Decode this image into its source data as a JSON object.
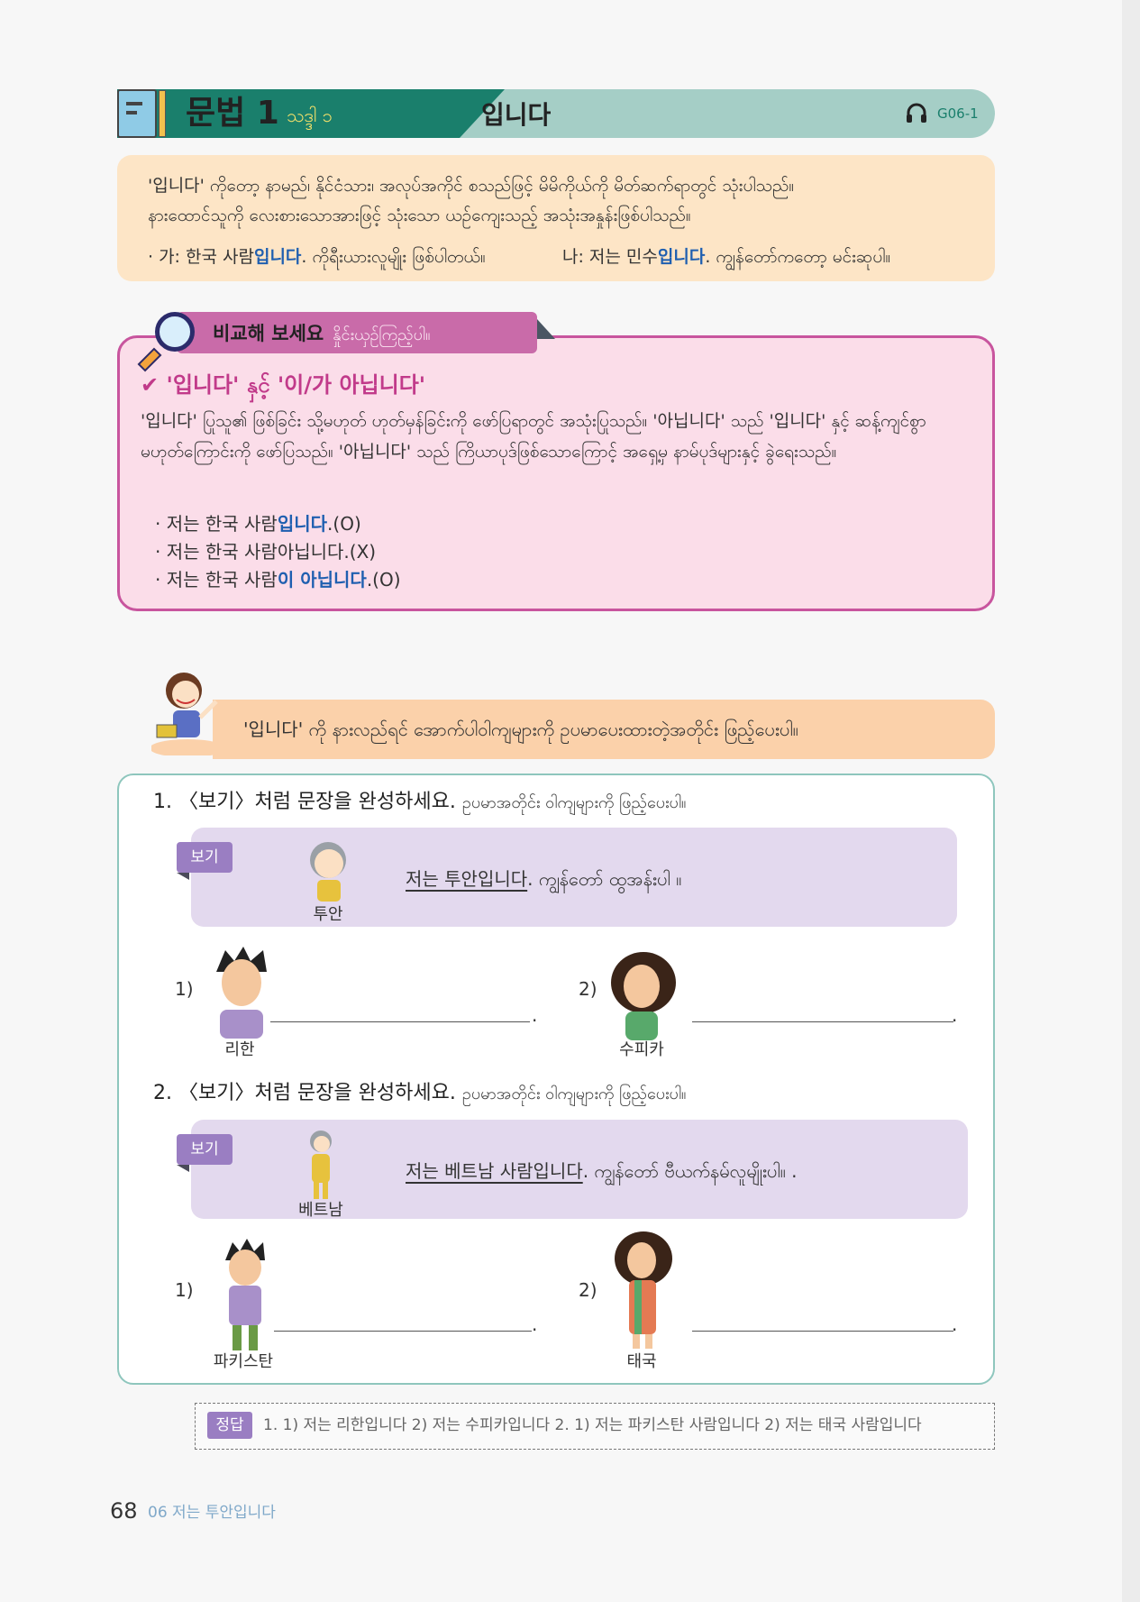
{
  "header": {
    "title": "문법 1",
    "subtitle": "သဒ္ဒါ ၁",
    "topic": "입니다",
    "audio_code": "G06-1"
  },
  "explanation": {
    "line1": "'입니다' ကိုတော့ နာမည်၊ နိုင်ငံသား၊ အလုပ်အကိုင် စသည်ဖြင့် မိမိကိုယ်ကို မိတ်ဆက်ရာတွင် သုံးပါသည်။",
    "line2": "နားထောင်သူကို လေးစားသောအားဖြင့် သုံးသော ယဉ်ကျေးသည့် အသုံးအနှုန်းဖြစ်ပါသည်။",
    "ex1_pre": "· 가: 한국 사람",
    "ex1_hl": "입니다",
    "ex1_post": ". ကိုရီးယားလူမျိုး ဖြစ်ပါတယ်။",
    "ex2_pre": "나: 저는 민수",
    "ex2_hl": "입니다",
    "ex2_post": ". ကျွန်တော်ကတော့ မင်းဆုပါ။"
  },
  "compare": {
    "label": "비교해 보세요",
    "label_sub": "နှိုင်းယှဉ်ကြည့်ပါ။",
    "heading": "✔ '입니다' နှင့် '이/가 아닙니다'",
    "text": "'입니다' ပြုသူ၏ ဖြစ်ခြင်း သို့မဟုတ် ဟုတ်မှန်ခြင်းကို ဖော်ပြရာတွင် အသုံးပြုသည်။ '아닙니다' သည် '입니다' နှင့် ဆန့်ကျင်စွာ မဟုတ်ကြောင်းကို ဖော်ပြသည်။ '아닙니다' သည် ကြိယာပုဒ်ဖြစ်သောကြောင့် အရှေ့မှ နာမ်ပုဒ်များနှင့် ခွဲရေးသည်။",
    "ex1_pre": "· 저는 한국 사람",
    "ex1_hl": "입니다",
    "ex1_post": ".(O)",
    "ex2": "· 저는 한국 사람아닙니다.(X)",
    "ex3_pre": "· 저는 한국 사람",
    "ex3_hl": "이 아닙니다",
    "ex3_post": ".(O)"
  },
  "instruction": "'입니다' ကို နားလည်ရင် အောက်ပါဝါကျများကို ဥပမာပေးထားတဲ့အတိုင်း ဖြည့်ပေးပါ။",
  "exercise1": {
    "question": "1. 〈보기〉처럼 문장을 완성하세요.",
    "question_sub": "ဥပမာအတိုင်း ဝါကျများကို ဖြည့်ပေးပါ။",
    "bogi_tag": "보기",
    "example_name": "투안",
    "example_answer": "저는 투안입니다",
    "example_translation": ". ကျွန်တော် ထွအန်းပါ ။",
    "item1_num": "1)",
    "item1_name": "리한",
    "item2_num": "2)",
    "item2_name": "수피카"
  },
  "exercise2": {
    "question": "2. 〈보기〉처럼 문장을 완성하세요.",
    "question_sub": "ဥပမာအတိုင်း ဝါကျများကို ဖြည့်ပေးပါ။",
    "bogi_tag": "보기",
    "example_name": "베트남",
    "example_answer": "저는 베트남 사람입니다",
    "example_translation": ". ကျွန်တော် ဗီယက်နမ်လူမျိုးပါ။ .",
    "item1_num": "1)",
    "item1_name": "파키스탄",
    "item2_num": "2)",
    "item2_name": "태국"
  },
  "answers": {
    "tag": "정답",
    "text": "1. 1) 저는 리한입니다  2) 저는 수피카입니다    2. 1) 저는 파키스탄 사람입니다  2) 저는 태국 사람입니다"
  },
  "footer": {
    "page": "68",
    "chapter": "06 저는 투안입니다"
  },
  "colors": {
    "header_green": "#1a7f6c",
    "header_light": "#a5cec6",
    "explain_bg": "#fde5c6",
    "compare_pink": "#c8559e",
    "highlight_blue": "#1f5fb0",
    "bogi_purple": "#9a7ec2"
  }
}
